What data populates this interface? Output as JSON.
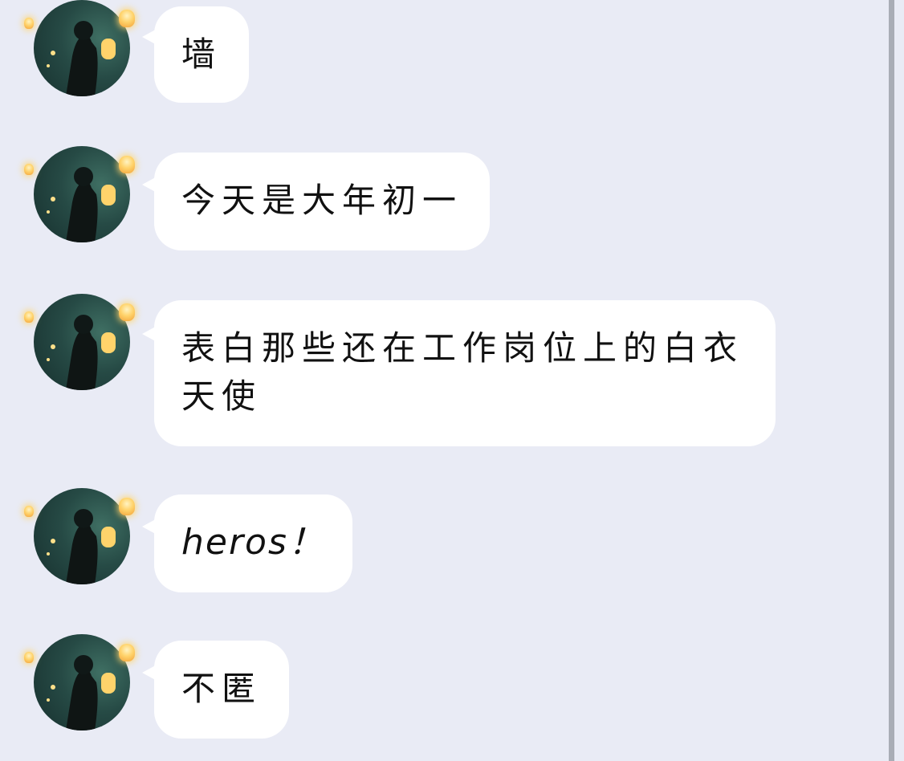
{
  "messages": [
    {
      "text": "墙"
    },
    {
      "text": "今天是大年初一"
    },
    {
      "text": "表白那些还在工作岗位上的白衣天使"
    },
    {
      "text": "heros！"
    },
    {
      "text": "不匿"
    }
  ],
  "colors": {
    "background": "#e9ebf5",
    "bubble": "#ffffff",
    "text": "#111111",
    "scrollbar": "#a9adb6"
  },
  "icons": {
    "avatar": "user-avatar-lanterns"
  }
}
